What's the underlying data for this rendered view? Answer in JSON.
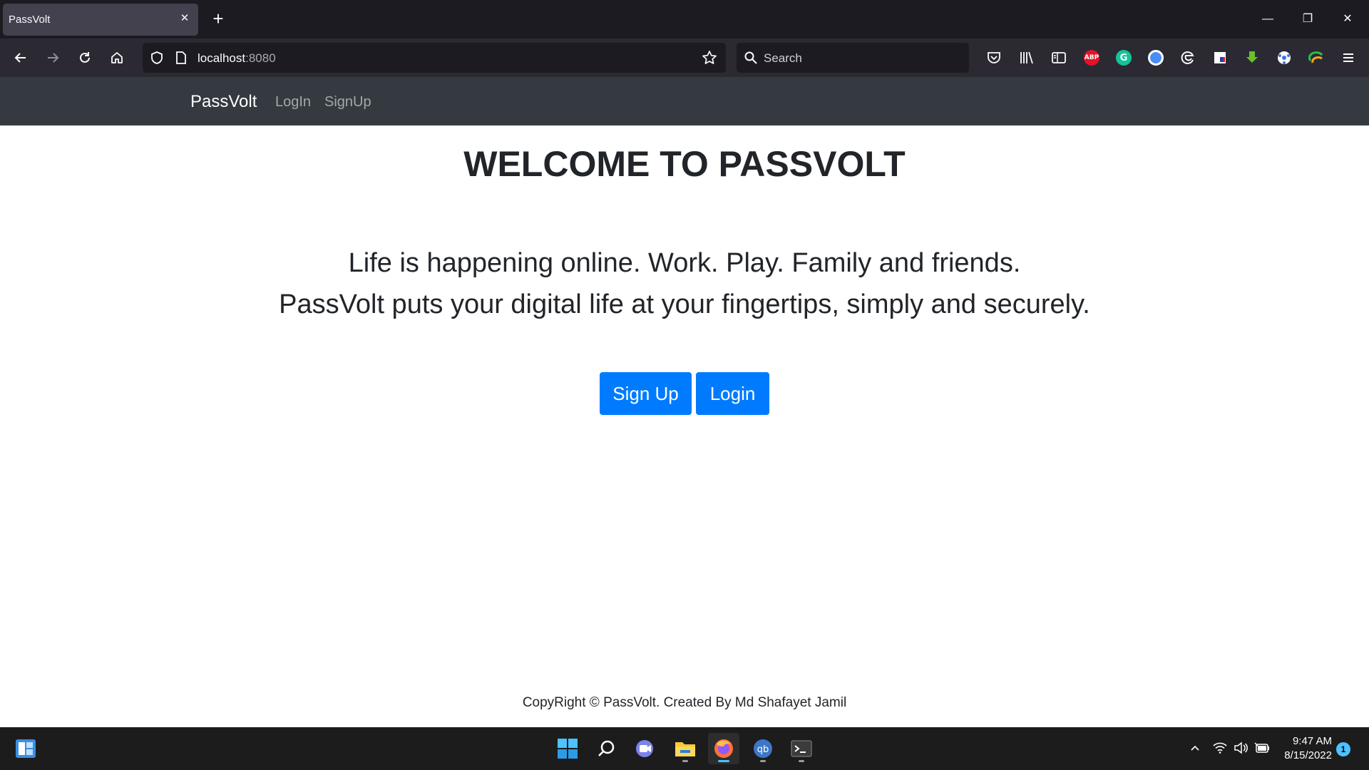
{
  "browser": {
    "tab_title": "PassVolt",
    "tab_close": "✕",
    "new_tab": "+",
    "url_host": "localhost",
    "url_port": ":8080",
    "search_placeholder": "Search",
    "window_controls": [
      "—",
      "❐",
      "✕"
    ],
    "extensions": [
      {
        "name": "adblock-plus-icon",
        "label": "ABP",
        "color": "#e3132b"
      },
      {
        "name": "grammarly-icon",
        "label": "G",
        "color": "#15c39a"
      }
    ]
  },
  "site": {
    "brand": "PassVolt",
    "nav": {
      "login": "LogIn",
      "signup": "SignUp"
    },
    "title": "WELCOME TO PASSVOLT",
    "tagline_line1": "Life is happening online. Work. Play. Family and friends.",
    "tagline_line2": "PassVolt puts your digital life at your fingertips, simply and securely.",
    "buttons": {
      "signup": "Sign Up",
      "login": "Login"
    },
    "footer": "CopyRight © PassVolt. Created By Md Shafayet Jamil",
    "colors": {
      "navbar": "#343a40",
      "primary": "#007bff",
      "text": "#212529"
    }
  },
  "taskbar": {
    "time": "9:47 AM",
    "date": "8/15/2022",
    "notifications": "1",
    "accent": "#4cc2ff"
  }
}
